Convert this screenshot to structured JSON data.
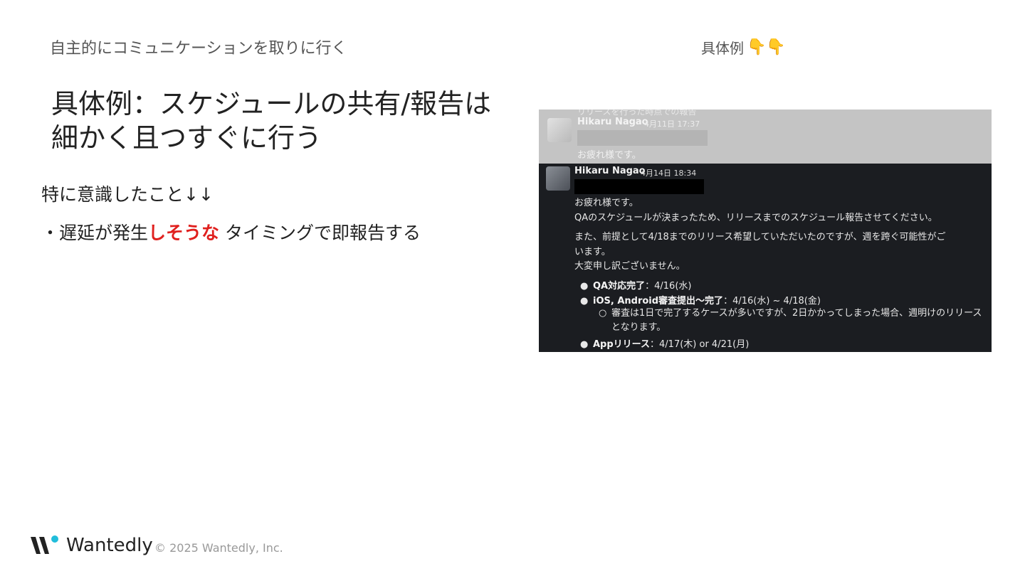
{
  "header": {
    "section": "自主的にコミュニケーションを取りに行く",
    "example_label": "具体例",
    "example_emoji": "👇👇"
  },
  "slide": {
    "title_line1": "具体例：スケジュールの共有/報告は",
    "title_line2": "細かく且つすぐに行う",
    "subheading": "特に意識したこと↓↓",
    "bullet_prefix": "・遅延が発生",
    "bullet_highlight": "しそうな",
    "bullet_suffix": " タイミングで即報告する"
  },
  "chat": {
    "faded_msg": {
      "top_text": "リリースを行った時点での報告",
      "author": "Hikaru Nagao",
      "timestamp": "4月11日 17:37",
      "greeting": "お疲れ様です。"
    },
    "main_msg": {
      "author": "Hikaru Nagao",
      "timestamp": "4月14日 18:34",
      "line1": "お疲れ様です。",
      "line2": "QAのスケジュールが決まったため、リリースまでのスケジュール報告させてください。",
      "line3": "また、前提として4/18までのリリース希望していただいたのですが、週を跨ぐ可能性がご",
      "line4": "います。",
      "line5": "大変申し訳ございません。",
      "items": [
        {
          "label": "QA対応完了",
          "value": "：4/16(水)"
        },
        {
          "label": "iOS, Android審査提出〜完了",
          "value": "：4/16(水) ~ 4/18(金)"
        },
        {
          "label": "Appリリース",
          "value": "：4/17(木) or 4/21(月)"
        }
      ],
      "sub_item": "審査は1日で完了するケースが多いですが、2日かかってしまった場合、週明けのリリースとなります。"
    }
  },
  "footer": {
    "logo": "Wantedly",
    "copyright": "© 2025 Wantedly, Inc."
  },
  "colors": {
    "highlight": "#e0201e",
    "chat_bg": "#1b1d21",
    "logo_accent": "#21bddb"
  }
}
